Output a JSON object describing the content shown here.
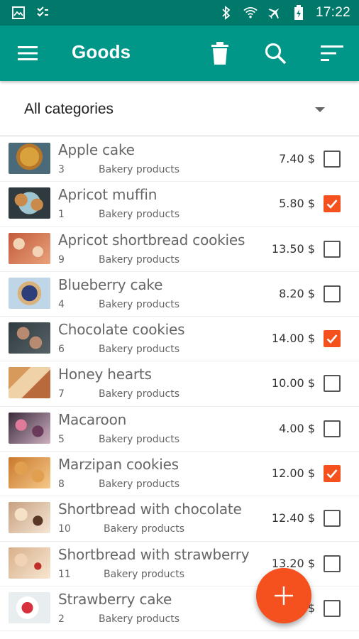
{
  "status_bar": {
    "time": "17:22",
    "icons": [
      "gallery-icon",
      "tasks-icon",
      "bluetooth-icon",
      "wifi-icon",
      "airplane-icon",
      "battery-icon"
    ]
  },
  "app_bar": {
    "title": "Goods",
    "color": "#009688",
    "status_color": "#00796b",
    "actions": [
      "menu-icon",
      "delete-icon",
      "search-icon",
      "sort-icon"
    ]
  },
  "category_filter": {
    "selected": "All categories"
  },
  "accent_color": "#f4511e",
  "items": [
    {
      "name": "Apple cake",
      "qty": "3",
      "category": "Bakery products",
      "price": "7.40 $",
      "checked": false
    },
    {
      "name": "Apricot muffin",
      "qty": "1",
      "category": "Bakery products",
      "price": "5.80 $",
      "checked": true
    },
    {
      "name": "Apricot shortbread cookies",
      "qty": "9",
      "category": "Bakery products",
      "price": "13.50 $",
      "checked": false
    },
    {
      "name": "Blueberry cake",
      "qty": "4",
      "category": "Bakery products",
      "price": "8.20 $",
      "checked": false
    },
    {
      "name": "Chocolate cookies",
      "qty": "6",
      "category": "Bakery products",
      "price": "14.00 $",
      "checked": true
    },
    {
      "name": "Honey hearts",
      "qty": "7",
      "category": "Bakery products",
      "price": "10.00 $",
      "checked": false
    },
    {
      "name": "Macaroon",
      "qty": "5",
      "category": "Bakery products",
      "price": "4.00 $",
      "checked": false
    },
    {
      "name": "Marzipan cookies",
      "qty": "8",
      "category": "Bakery products",
      "price": "12.00 $",
      "checked": true
    },
    {
      "name": "Shortbread with chocolate",
      "qty": "10",
      "category": "Bakery products",
      "price": "12.40 $",
      "checked": false
    },
    {
      "name": "Shortbread with strawberry",
      "qty": "11",
      "category": "Bakery products",
      "price": "13.20 $",
      "checked": false
    },
    {
      "name": "Strawberry cake",
      "qty": "2",
      "category": "Bakery products",
      "price": "$",
      "checked": false
    }
  ]
}
